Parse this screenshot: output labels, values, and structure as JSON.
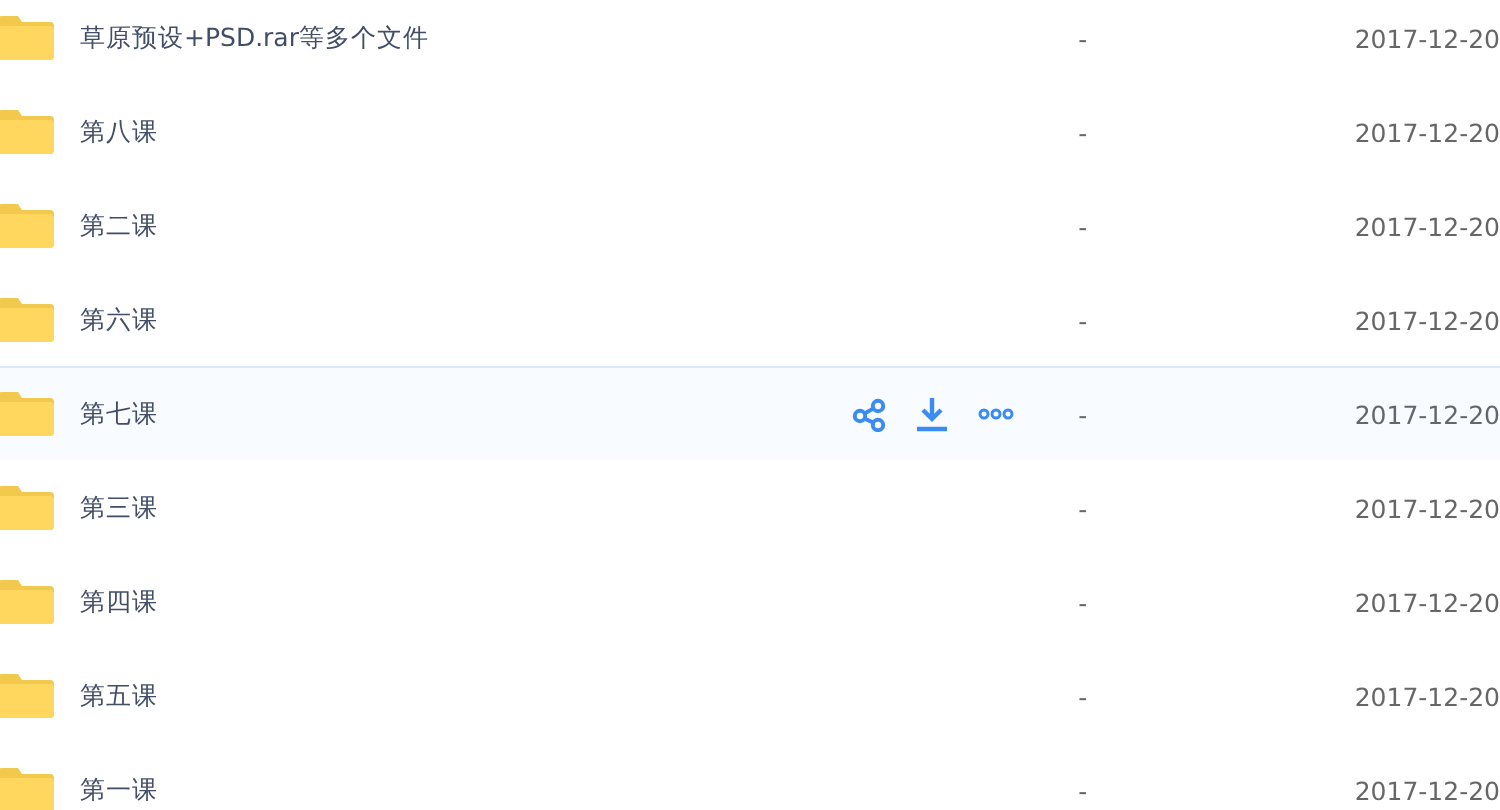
{
  "files": [
    {
      "name": "草原预设+PSD.rar等多个文件",
      "size": "-",
      "date": "2017-12-20",
      "hovered": false
    },
    {
      "name": "第八课",
      "size": "-",
      "date": "2017-12-20",
      "hovered": false
    },
    {
      "name": "第二课",
      "size": "-",
      "date": "2017-12-20",
      "hovered": false
    },
    {
      "name": "第六课",
      "size": "-",
      "date": "2017-12-20",
      "hovered": false
    },
    {
      "name": "第七课",
      "size": "-",
      "date": "2017-12-20",
      "hovered": true
    },
    {
      "name": "第三课",
      "size": "-",
      "date": "2017-12-20",
      "hovered": false
    },
    {
      "name": "第四课",
      "size": "-",
      "date": "2017-12-20",
      "hovered": false
    },
    {
      "name": "第五课",
      "size": "-",
      "date": "2017-12-20",
      "hovered": false
    },
    {
      "name": "第一课",
      "size": "-",
      "date": "2017-12-20",
      "hovered": false
    }
  ]
}
